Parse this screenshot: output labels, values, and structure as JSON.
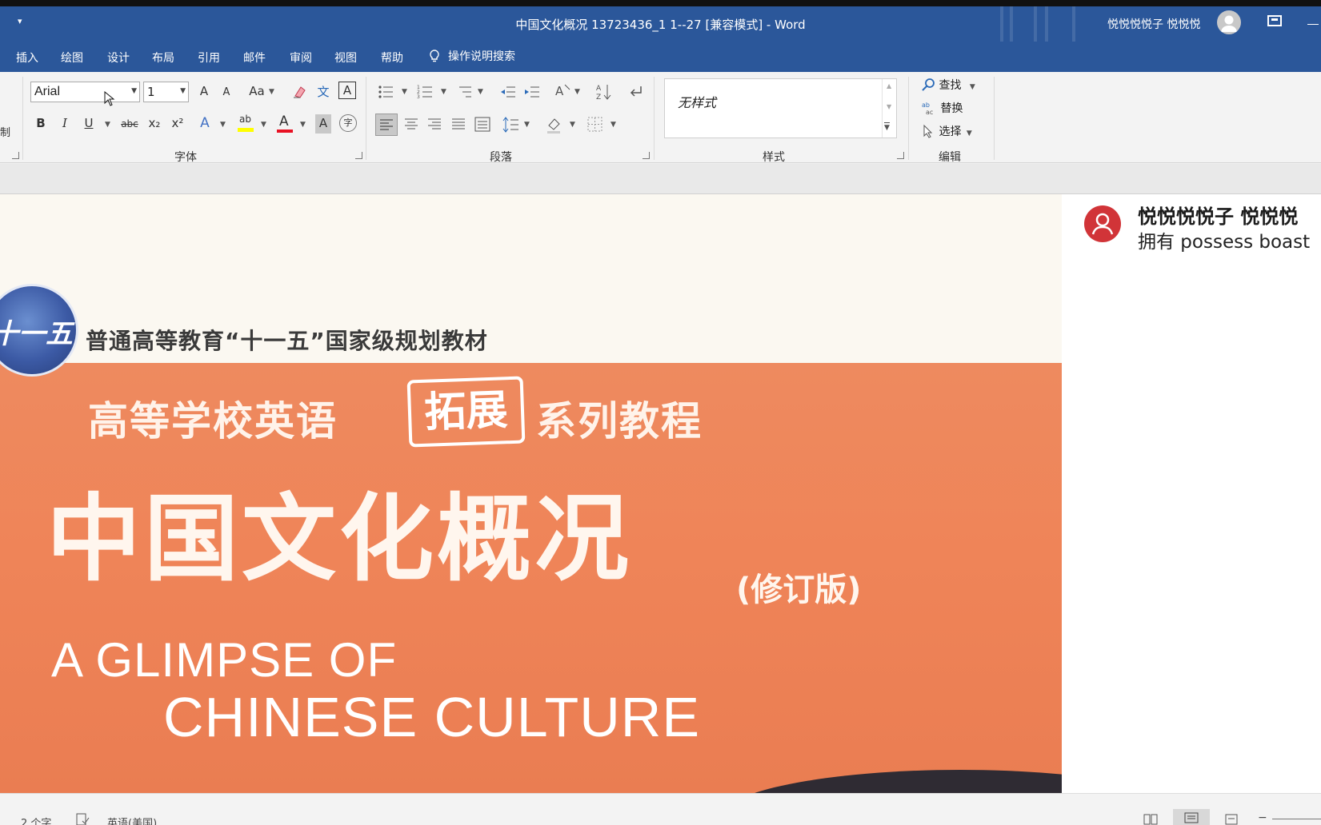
{
  "window": {
    "title": "中国文化概况 13723436_1  1--27 [兼容模式]  -  Word",
    "user_name": "悦悦悦悦子 悦悦悦",
    "qat_more": "▾"
  },
  "tabs": [
    "插入",
    "绘图",
    "设计",
    "布局",
    "引用",
    "邮件",
    "审阅",
    "视图",
    "帮助"
  ],
  "tell_me": {
    "label": "操作说明搜索",
    "icon": "lightbulb-icon"
  },
  "ribbon": {
    "clipboard_fragment": "制",
    "font": {
      "group_label": "字体",
      "font_name": "Arial",
      "font_size": "1",
      "grow_label": "A",
      "shrink_label": "A",
      "change_case_label": "Aa",
      "phonetic_label": "文",
      "bold": "B",
      "italic": "I",
      "underline": "U",
      "strikethrough": "abc",
      "subscript": "x₂",
      "superscript": "x²",
      "text_effects": "A",
      "highlight": "ab",
      "font_color": "A",
      "char_shading": "A",
      "enclose": "字",
      "colors": {
        "font_color_bar": "#e81123",
        "highlight_bar": "#ffff00",
        "text_effects": "#4472c4"
      }
    },
    "paragraph": {
      "group_label": "段落"
    },
    "styles": {
      "group_label": "样式",
      "current_style": "无样式"
    },
    "editing": {
      "group_label": "编辑",
      "find": "查找",
      "replace": "替换",
      "select": "选择"
    }
  },
  "cover": {
    "subtitle": "普通高等教育“十一五”国家级规划教材",
    "logo_text": "十一五",
    "series_left": "高等学校英语",
    "series_stamp": "拓展",
    "series_right": "系列教程",
    "cn_title": "中国文化概况",
    "cn_title_suffix": "(修订版)",
    "en_title_line1": "A GLIMPSE OF",
    "en_title_line2": "CHINESE CULTURE"
  },
  "comment": {
    "author": "悦悦悦悦子 悦悦悦",
    "text": "拥有 possess  boast"
  },
  "status": {
    "word_count": "2 个字",
    "language": "英语(美国)"
  },
  "colors": {
    "accent": "#2b579a",
    "cover_orange": "#ee8a5f",
    "comment_avatar": "#d13438"
  }
}
